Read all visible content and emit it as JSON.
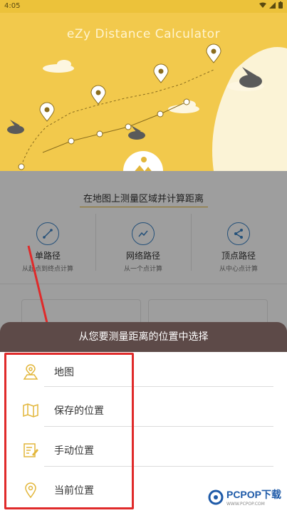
{
  "status_bar": {
    "time": "4:05"
  },
  "app": {
    "title": "eZy Distance Calculator"
  },
  "section": {
    "title": "在地图上测量区域并计算距离"
  },
  "modes": [
    {
      "name": "单路径",
      "sub": "从起点到终点计算",
      "icon": "single-path-icon"
    },
    {
      "name": "网络路径",
      "sub": "从一个点计算",
      "icon": "network-path-icon"
    },
    {
      "name": "顶点路径",
      "sub": "从中心点计算",
      "icon": "vertex-path-icon"
    }
  ],
  "sheet": {
    "title": "从您要测量距离的位置中选择",
    "items": [
      {
        "label": "地图",
        "icon": "map-marker-icon"
      },
      {
        "label": "保存的位置",
        "icon": "folded-map-icon"
      },
      {
        "label": "手动位置",
        "icon": "edit-note-icon"
      },
      {
        "label": "当前位置",
        "icon": "location-pin-icon"
      }
    ]
  },
  "watermark": {
    "brand": "PCPOP下载",
    "sub": "WWW.PCPOP.COM"
  },
  "colors": {
    "hero": "#f2c94c",
    "sheet_header": "#5d4a48",
    "accent_blue": "#3a82c4",
    "highlight_red": "#e02a2a",
    "icon_yellow": "#e2b63a"
  }
}
